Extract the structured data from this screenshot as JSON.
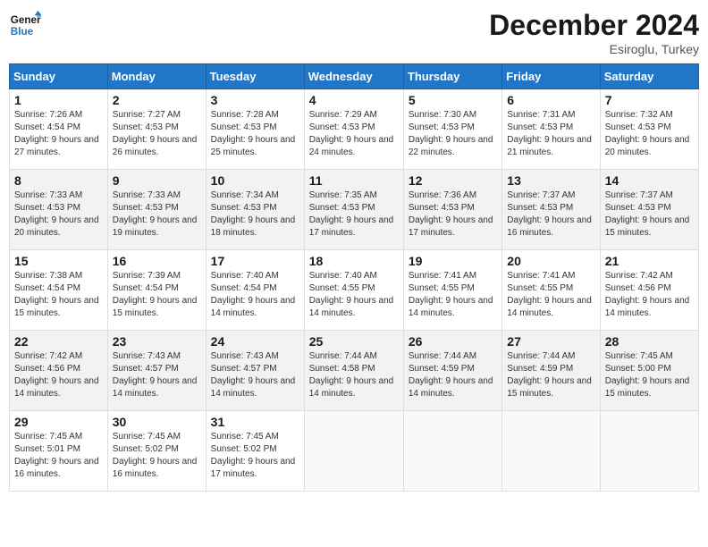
{
  "logo": {
    "line1": "General",
    "line2": "Blue"
  },
  "title": "December 2024",
  "location": "Esiroglu, Turkey",
  "days_header": [
    "Sunday",
    "Monday",
    "Tuesday",
    "Wednesday",
    "Thursday",
    "Friday",
    "Saturday"
  ],
  "weeks": [
    [
      {
        "num": "1",
        "sunrise": "7:26 AM",
        "sunset": "4:54 PM",
        "daylight": "9 hours and 27 minutes."
      },
      {
        "num": "2",
        "sunrise": "7:27 AM",
        "sunset": "4:53 PM",
        "daylight": "9 hours and 26 minutes."
      },
      {
        "num": "3",
        "sunrise": "7:28 AM",
        "sunset": "4:53 PM",
        "daylight": "9 hours and 25 minutes."
      },
      {
        "num": "4",
        "sunrise": "7:29 AM",
        "sunset": "4:53 PM",
        "daylight": "9 hours and 24 minutes."
      },
      {
        "num": "5",
        "sunrise": "7:30 AM",
        "sunset": "4:53 PM",
        "daylight": "9 hours and 22 minutes."
      },
      {
        "num": "6",
        "sunrise": "7:31 AM",
        "sunset": "4:53 PM",
        "daylight": "9 hours and 21 minutes."
      },
      {
        "num": "7",
        "sunrise": "7:32 AM",
        "sunset": "4:53 PM",
        "daylight": "9 hours and 20 minutes."
      }
    ],
    [
      {
        "num": "8",
        "sunrise": "7:33 AM",
        "sunset": "4:53 PM",
        "daylight": "9 hours and 20 minutes."
      },
      {
        "num": "9",
        "sunrise": "7:33 AM",
        "sunset": "4:53 PM",
        "daylight": "9 hours and 19 minutes."
      },
      {
        "num": "10",
        "sunrise": "7:34 AM",
        "sunset": "4:53 PM",
        "daylight": "9 hours and 18 minutes."
      },
      {
        "num": "11",
        "sunrise": "7:35 AM",
        "sunset": "4:53 PM",
        "daylight": "9 hours and 17 minutes."
      },
      {
        "num": "12",
        "sunrise": "7:36 AM",
        "sunset": "4:53 PM",
        "daylight": "9 hours and 17 minutes."
      },
      {
        "num": "13",
        "sunrise": "7:37 AM",
        "sunset": "4:53 PM",
        "daylight": "9 hours and 16 minutes."
      },
      {
        "num": "14",
        "sunrise": "7:37 AM",
        "sunset": "4:53 PM",
        "daylight": "9 hours and 15 minutes."
      }
    ],
    [
      {
        "num": "15",
        "sunrise": "7:38 AM",
        "sunset": "4:54 PM",
        "daylight": "9 hours and 15 minutes."
      },
      {
        "num": "16",
        "sunrise": "7:39 AM",
        "sunset": "4:54 PM",
        "daylight": "9 hours and 15 minutes."
      },
      {
        "num": "17",
        "sunrise": "7:40 AM",
        "sunset": "4:54 PM",
        "daylight": "9 hours and 14 minutes."
      },
      {
        "num": "18",
        "sunrise": "7:40 AM",
        "sunset": "4:55 PM",
        "daylight": "9 hours and 14 minutes."
      },
      {
        "num": "19",
        "sunrise": "7:41 AM",
        "sunset": "4:55 PM",
        "daylight": "9 hours and 14 minutes."
      },
      {
        "num": "20",
        "sunrise": "7:41 AM",
        "sunset": "4:55 PM",
        "daylight": "9 hours and 14 minutes."
      },
      {
        "num": "21",
        "sunrise": "7:42 AM",
        "sunset": "4:56 PM",
        "daylight": "9 hours and 14 minutes."
      }
    ],
    [
      {
        "num": "22",
        "sunrise": "7:42 AM",
        "sunset": "4:56 PM",
        "daylight": "9 hours and 14 minutes."
      },
      {
        "num": "23",
        "sunrise": "7:43 AM",
        "sunset": "4:57 PM",
        "daylight": "9 hours and 14 minutes."
      },
      {
        "num": "24",
        "sunrise": "7:43 AM",
        "sunset": "4:57 PM",
        "daylight": "9 hours and 14 minutes."
      },
      {
        "num": "25",
        "sunrise": "7:44 AM",
        "sunset": "4:58 PM",
        "daylight": "9 hours and 14 minutes."
      },
      {
        "num": "26",
        "sunrise": "7:44 AM",
        "sunset": "4:59 PM",
        "daylight": "9 hours and 14 minutes."
      },
      {
        "num": "27",
        "sunrise": "7:44 AM",
        "sunset": "4:59 PM",
        "daylight": "9 hours and 15 minutes."
      },
      {
        "num": "28",
        "sunrise": "7:45 AM",
        "sunset": "5:00 PM",
        "daylight": "9 hours and 15 minutes."
      }
    ],
    [
      {
        "num": "29",
        "sunrise": "7:45 AM",
        "sunset": "5:01 PM",
        "daylight": "9 hours and 16 minutes."
      },
      {
        "num": "30",
        "sunrise": "7:45 AM",
        "sunset": "5:02 PM",
        "daylight": "9 hours and 16 minutes."
      },
      {
        "num": "31",
        "sunrise": "7:45 AM",
        "sunset": "5:02 PM",
        "daylight": "9 hours and 17 minutes."
      },
      null,
      null,
      null,
      null
    ]
  ]
}
